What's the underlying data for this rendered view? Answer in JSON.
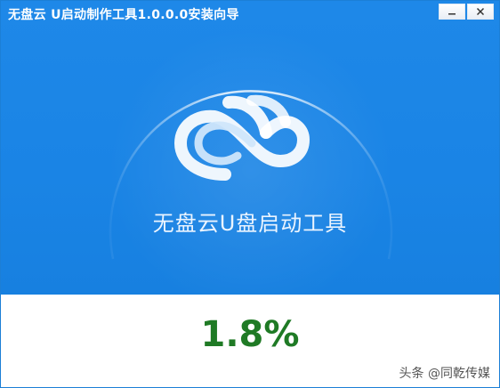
{
  "window": {
    "title": "无盘云 U启动制作工具1.0.0.0安装向导",
    "minimize_icon": "minimize-icon",
    "close_icon": "close-icon"
  },
  "splash": {
    "logo_icon": "cloud-infinity-logo-icon",
    "app_name": "无盘云U盘启动工具"
  },
  "install": {
    "progress_text": "1.8%",
    "progress_value": 0.018
  },
  "watermark": {
    "text": "头条 @同乾传媒"
  },
  "colors": {
    "header_blue": "#1a84e5",
    "progress_green": "#1f7a25",
    "text_white": "#ffffff"
  }
}
